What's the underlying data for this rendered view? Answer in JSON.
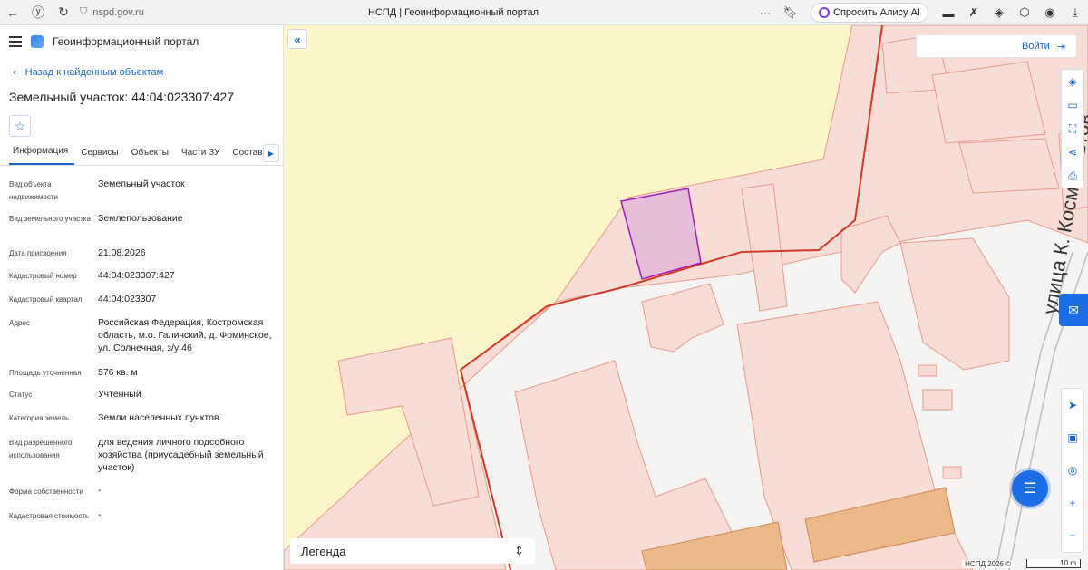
{
  "browser": {
    "url": "nspd.gov.ru",
    "tab_title": "НСПД | Геоинформационный портал",
    "alice_label": "Спросить Алису AI",
    "dots": "···"
  },
  "portal": {
    "name": "Геоинформационный портал",
    "back_label": "Назад к найденным объектам",
    "object_title": "Земельный участок: 44:04:023307:427"
  },
  "tabs": [
    {
      "label": "Информация"
    },
    {
      "label": "Сервисы"
    },
    {
      "label": "Объекты"
    },
    {
      "label": "Части ЗУ"
    },
    {
      "label": "Состав"
    }
  ],
  "properties": [
    {
      "label": "Вид объекта недвижимости",
      "value": "Земельный участок"
    },
    {
      "label": "Вид земельного участка",
      "value": "Землепользование"
    },
    {
      "label": "Дата присвоения",
      "value": "21.08.2026"
    },
    {
      "label": "Кадастровый номер",
      "value": "44:04:023307:427"
    },
    {
      "label": "Кадастровый квартал",
      "value": "44:04:023307"
    },
    {
      "label": "Адрес",
      "value": "Российская Федерация, Костромская область, м.о. Галичский, д. Фоминское, ул. Солнечная, з/у 46"
    },
    {
      "label": "Площадь уточненная",
      "value": "576 кв. м"
    },
    {
      "label": "Статус",
      "value": "Учтенный"
    },
    {
      "label": "Категория земель",
      "value": "Земли населенных пунктов"
    },
    {
      "label": "Вид разрешенного использования",
      "value": "для ведения личного подсобного хозяйства (приусадебный земельный участок)"
    },
    {
      "label": "Форма собственности",
      "value": "-"
    },
    {
      "label": "Кадастровая стоимость",
      "value": "-"
    }
  ],
  "map": {
    "login_label": "Войти",
    "legend_label": "Легенда",
    "copyright": "НСПД 2026 ©",
    "scale_label": "10 m",
    "street_label": "улица К. Космонавтов",
    "colors": {
      "parcel_fill": "#f8dcd6",
      "parcel_stroke": "#e59a8c",
      "boundary": "#d23b2a",
      "forest": "#fbf5c9",
      "selected_fill": "#e5bdd8",
      "selected_stroke": "#a21ab8",
      "building": "#ecb98a",
      "accent": "#1a64c8"
    }
  }
}
